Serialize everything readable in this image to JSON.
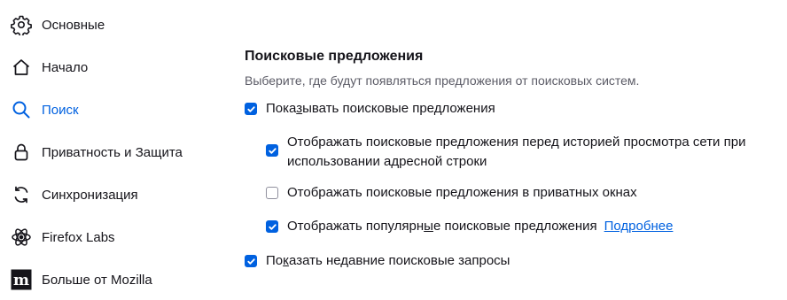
{
  "sidebar": {
    "items": [
      {
        "label": "Основные",
        "icon": "gear-icon",
        "selected": false
      },
      {
        "label": "Начало",
        "icon": "home-icon",
        "selected": false
      },
      {
        "label": "Поиск",
        "icon": "search-icon",
        "selected": true
      },
      {
        "label": "Приватность и Защита",
        "icon": "lock-icon",
        "selected": false
      },
      {
        "label": "Синхронизация",
        "icon": "sync-icon",
        "selected": false
      },
      {
        "label": "Firefox Labs",
        "icon": "atom-icon",
        "selected": false
      },
      {
        "label": "Больше от Mozilla",
        "icon": "mozilla-icon",
        "selected": false
      }
    ]
  },
  "suggestions": {
    "title": "Поисковые предложения",
    "description": "Выберите, где будут появляться предложения от поисковых систем.",
    "show_suggestions": {
      "pre": "Пока",
      "accesskey": "з",
      "post": "ывать поисковые предложения",
      "checked": true
    },
    "before_history": {
      "line1": "Отображать поисковые предложения перед историей просмотра сети при",
      "line2": "использовании адресной строки",
      "checked": true
    },
    "private_windows": {
      "label": "Отображать поисковые предложения в приватных окнах",
      "checked": false
    },
    "trending": {
      "pre": "Отображать популярн",
      "accesskey": "ы",
      "post": "е поисковые предложения",
      "checked": true,
      "link": "Подробнее"
    },
    "recent_searches": {
      "pre": "По",
      "accesskey": "к",
      "post": "азать недавние поисковые запросы",
      "checked": true
    }
  },
  "colors": {
    "accent": "#0061e0",
    "text": "#15141a",
    "secondary_text": "#5b5b66"
  }
}
